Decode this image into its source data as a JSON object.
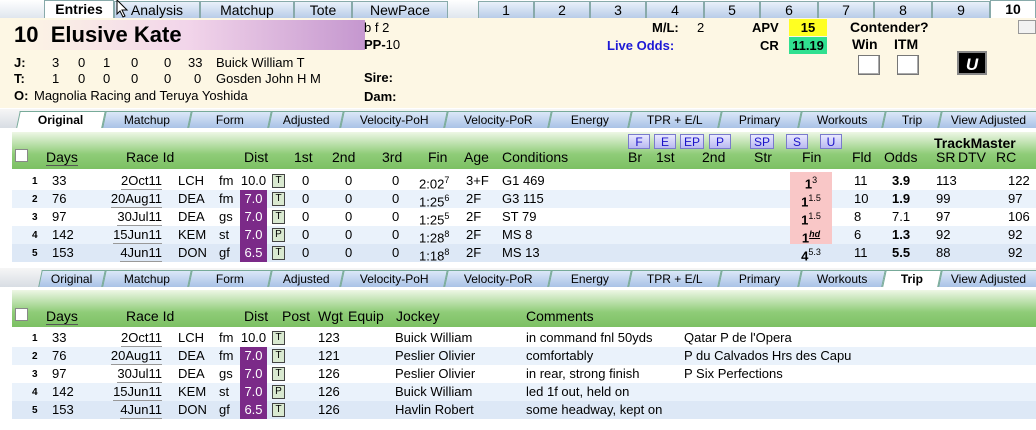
{
  "top_tabs": [
    "Entries",
    "Analysis",
    "Matchup",
    "Tote",
    "NewPace",
    "1",
    "2",
    "3",
    "4",
    "5",
    "6",
    "7",
    "8",
    "9",
    "10"
  ],
  "header": {
    "post": "10",
    "name": "Elusive Kate",
    "sex_age": "b f 2",
    "pp_label": "PP-",
    "pp": "10",
    "jockey_label": "J:",
    "jockey_stats": [
      "3",
      "0",
      "1",
      "0",
      "0",
      "33"
    ],
    "jockey_name": "Buick William T",
    "trainer_label": "T:",
    "trainer_stats": [
      "1",
      "0",
      "0",
      "0",
      "0",
      "0"
    ],
    "trainer_name": "Gosden John H M",
    "owner_label": "O:",
    "owner": "Magnolia Racing and Teruya Yoshida",
    "sire_label": "Sire:",
    "dam_label": "Dam:",
    "ml_label": "M/L:",
    "ml": "2",
    "live_odds_label": "Live Odds:",
    "apv_label": "APV",
    "apv": "15",
    "cr_label": "CR",
    "cr": "11.19",
    "contender_label": "Contender?",
    "win_label": "Win",
    "itm_label": "ITM",
    "u_button": "U",
    "accent_apv": "#ffff22",
    "accent_cr": "#30e090"
  },
  "sub_tabs": [
    "Original",
    "Matchup",
    "Form",
    "Adjusted",
    "Velocity-PoH",
    "Velocity-PoR",
    "Energy",
    "TPR + E/L",
    "Primary",
    "Workouts",
    "Trip",
    "View Adjusted"
  ],
  "table1": {
    "selected_tab": "Original",
    "pace_buttons": [
      "F",
      "E",
      "EP",
      "P",
      "SP",
      "S",
      "U"
    ],
    "brand": "TrackMaster",
    "headers": {
      "days": "Days",
      "race_id": "Race Id",
      "dist": "Dist",
      "first": "1st",
      "second": "2nd",
      "third": "3rd",
      "fin": "Fin",
      "age": "Age",
      "conditions": "Conditions",
      "br": "Br",
      "c1st": "1st",
      "c2nd": "2nd",
      "str": "Str",
      "fin2": "Fin",
      "fld": "Fld",
      "odds": "Odds",
      "sr": "SR",
      "dtv": "DTV",
      "rc": "RC"
    },
    "rows": [
      {
        "n": "1",
        "days": "33",
        "date": "2Oct11",
        "trk": "LCH",
        "surf": "fm",
        "dist": "10.0",
        "flag": "T",
        "first": "0",
        "second": "0",
        "third": "0",
        "fin": "2:02",
        "fin_sup": "7",
        "age": "3+F",
        "cond": "G1 469",
        "finpos": "1",
        "finpos_sup": "3",
        "fld": "11",
        "odds": "3.9",
        "sr": "113",
        "dtv": "",
        "rc": "122"
      },
      {
        "n": "2",
        "days": "76",
        "date": "20Aug11",
        "trk": "DEA",
        "surf": "fm",
        "dist": "7.0",
        "flag": "T",
        "first": "0",
        "second": "0",
        "third": "0",
        "fin": "1:25",
        "fin_sup": "6",
        "age": "2F",
        "cond": "G3 115",
        "finpos": "1",
        "finpos_sup": "1.5",
        "fld": "10",
        "odds": "1.9",
        "sr": "99",
        "dtv": "",
        "rc": "97"
      },
      {
        "n": "3",
        "days": "97",
        "date": "30Jul11",
        "trk": "DEA",
        "surf": "gs",
        "dist": "7.0",
        "flag": "T",
        "first": "0",
        "second": "0",
        "third": "0",
        "fin": "1:25",
        "fin_sup": "5",
        "age": "2F",
        "cond": "ST 79",
        "finpos": "1",
        "finpos_sup": "1.5",
        "fld": "8",
        "odds": "7.1",
        "sr": "97",
        "dtv": "",
        "rc": "106"
      },
      {
        "n": "4",
        "days": "142",
        "date": "15Jun11",
        "trk": "KEM",
        "surf": "st",
        "dist": "7.0",
        "flag": "P",
        "first": "0",
        "second": "0",
        "third": "0",
        "fin": "1:28",
        "fin_sup": "8",
        "age": "2F",
        "cond": "MS 8",
        "finpos": "1",
        "finpos_sup": "hd",
        "fld": "6",
        "odds": "1.3",
        "sr": "92",
        "dtv": "",
        "rc": "92"
      },
      {
        "n": "5",
        "days": "153",
        "date": "4Jun11",
        "trk": "DON",
        "surf": "gf",
        "dist": "6.5",
        "flag": "T",
        "first": "0",
        "second": "0",
        "third": "0",
        "fin": "1:18",
        "fin_sup": "8",
        "age": "2F",
        "cond": "MS 13",
        "finpos": "4",
        "finpos_sup": "5.3",
        "fld": "11",
        "odds": "5.5",
        "sr": "88",
        "dtv": "",
        "rc": "92"
      }
    ]
  },
  "table2": {
    "selected_tab": "Trip",
    "headers": {
      "days": "Days",
      "race_id": "Race Id",
      "dist": "Dist",
      "post": "Post",
      "wgt": "Wgt",
      "equip": "Equip",
      "jockey": "Jockey",
      "comments": "Comments"
    },
    "rows": [
      {
        "n": "1",
        "days": "33",
        "date": "2Oct11",
        "trk": "LCH",
        "surf": "fm",
        "dist": "10.0",
        "flag": "T",
        "wgt": "123",
        "jockey": "Buick William",
        "comment": "in command fnl 50yds",
        "extra": "Qatar P de l'Opera"
      },
      {
        "n": "2",
        "days": "76",
        "date": "20Aug11",
        "trk": "DEA",
        "surf": "fm",
        "dist": "7.0",
        "flag": "T",
        "wgt": "121",
        "jockey": "Peslier Olivier",
        "comment": "comfortably",
        "extra": "P du Calvados Hrs des Capu"
      },
      {
        "n": "3",
        "days": "97",
        "date": "30Jul11",
        "trk": "DEA",
        "surf": "gs",
        "dist": "7.0",
        "flag": "T",
        "wgt": "126",
        "jockey": "Peslier Olivier",
        "comment": "in rear, strong finish",
        "extra": "P Six Perfections"
      },
      {
        "n": "4",
        "days": "142",
        "date": "15Jun11",
        "trk": "KEM",
        "surf": "st",
        "dist": "7.0",
        "flag": "P",
        "wgt": "126",
        "jockey": "Buick William",
        "comment": "led 1f out, held on",
        "extra": ""
      },
      {
        "n": "5",
        "days": "153",
        "date": "4Jun11",
        "trk": "DON",
        "surf": "gf",
        "dist": "6.5",
        "flag": "T",
        "wgt": "126",
        "jockey": "Havlin Robert",
        "comment": "some headway, kept on",
        "extra": ""
      }
    ]
  }
}
